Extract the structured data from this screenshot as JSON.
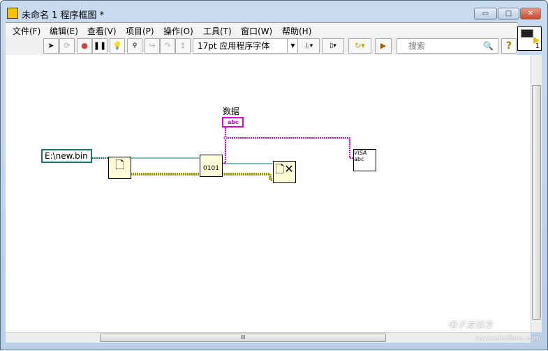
{
  "window": {
    "title": "未命名 1 程序框图 *",
    "minimize": "▭",
    "maximize": "□",
    "close": "✕"
  },
  "menu": [
    "文件(F)",
    "编辑(E)",
    "查看(V)",
    "项目(P)",
    "操作(O)",
    "工具(T)",
    "窗口(W)",
    "帮助(H)"
  ],
  "toolbar": {
    "font": "17pt 应用程序字体",
    "search_placeholder": "搜索",
    "help": "?"
  },
  "vi_icon": {
    "number": "1"
  },
  "diagram": {
    "path_constant": "E:\\new.bin",
    "indicator_label": "数据",
    "indicator_text": "abc",
    "write_node_text": "0101",
    "visa_node_text": "VISA",
    "visa_node_sub": "abc"
  },
  "scroll": {
    "grip": "III"
  },
  "watermark": {
    "cn": "电子发烧友",
    "url": "www.elecfans.com"
  },
  "colors": {
    "refnum": "#0d7a72",
    "string": "#e000e0",
    "error": "#c8c800",
    "node": "#fefcd6"
  }
}
